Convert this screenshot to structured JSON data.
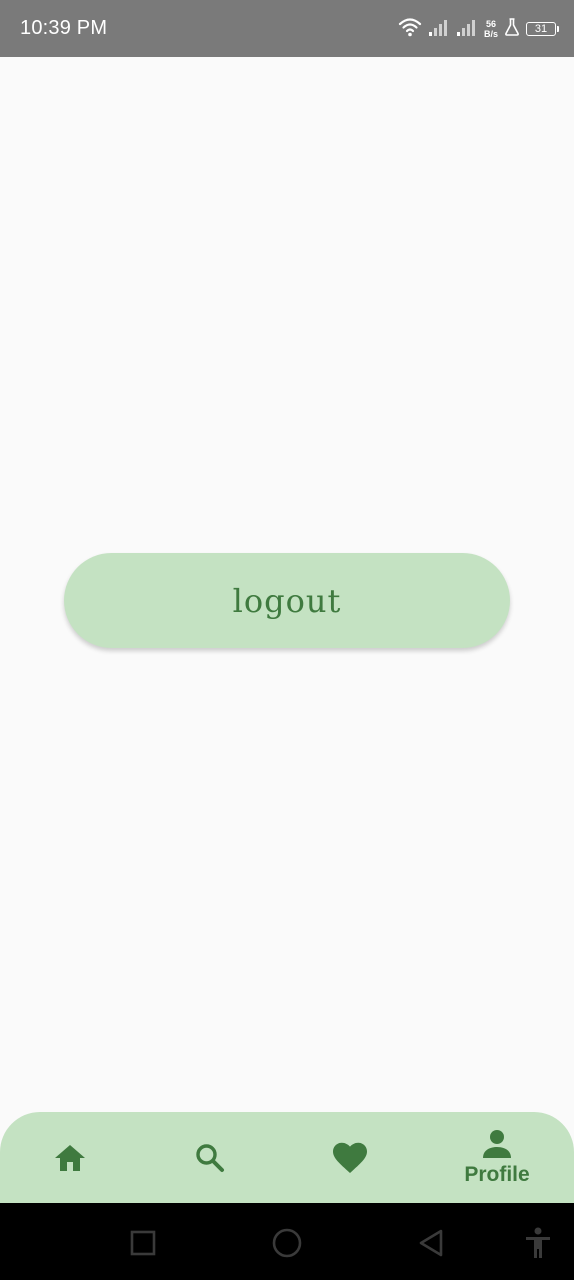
{
  "status_bar": {
    "time": "10:39 PM",
    "net_speed_value": "56",
    "net_speed_unit": "B/s",
    "battery_level": "31",
    "icons": [
      "wifi-icon",
      "signal-icon",
      "signal-icon",
      "lab-icon",
      "battery-icon"
    ]
  },
  "main": {
    "logout_label": "logout"
  },
  "bottom_nav": {
    "items": [
      {
        "icon": "home-icon",
        "label": "",
        "selected": false
      },
      {
        "icon": "search-icon",
        "label": "",
        "selected": false
      },
      {
        "icon": "heart-icon",
        "label": "",
        "selected": false
      },
      {
        "icon": "person-icon",
        "label": "Profile",
        "selected": true
      }
    ]
  },
  "system_nav": {
    "icons": [
      "square-icon",
      "circle-icon",
      "back-triangle-icon",
      "accessibility-icon"
    ]
  },
  "colors": {
    "accent": "#3f7a3f",
    "surface": "#c4e2c2",
    "background": "#fafafa",
    "status_bar": "#7a7a7a"
  }
}
